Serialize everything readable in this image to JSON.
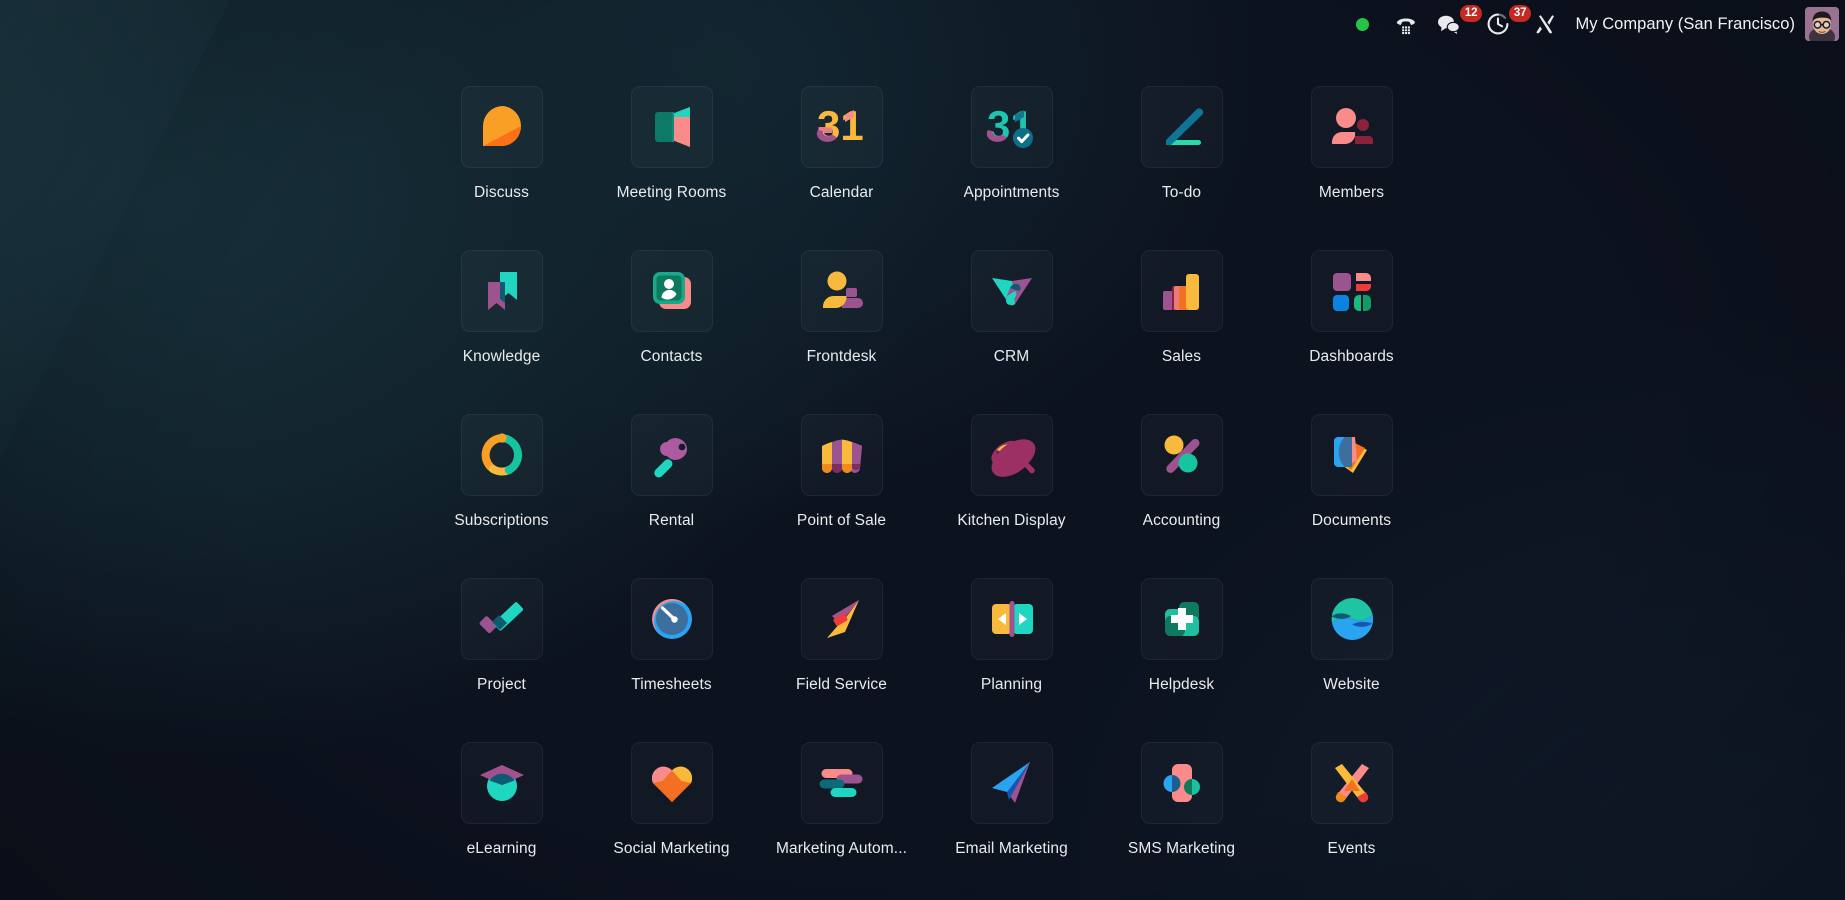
{
  "navbar": {
    "status": {
      "icon": "online-status-dot",
      "color": "#26c446",
      "label": ""
    },
    "phone": {
      "icon": "phone-dialpad-icon",
      "label": ""
    },
    "messages": {
      "icon": "chat-bubbles-icon",
      "badge": "12",
      "badge_color": "#c5291f"
    },
    "activities": {
      "icon": "clock-activity-icon",
      "badge": "37",
      "badge_color": "#c5291f"
    },
    "settings": {
      "icon": "tools-wrench-icon",
      "label": ""
    },
    "company": "My Company (San Francisco)",
    "avatar": {
      "icon": "user-avatar",
      "label": ""
    }
  },
  "apps": [
    {
      "label": "Discuss",
      "icon": "discuss-icon",
      "colors": [
        "#f99f26",
        "#f97316"
      ]
    },
    {
      "label": "Meeting Rooms",
      "icon": "meeting-rooms-icon",
      "colors": [
        "#17b8a6",
        "#0d7a68",
        "#f98b8b"
      ]
    },
    {
      "label": "Calendar",
      "icon": "calendar-31-icon",
      "colors": [
        "#f9b93c",
        "#a3508f",
        "#f98b8b"
      ]
    },
    {
      "label": "Appointments",
      "icon": "appointments-31-check-icon",
      "colors": [
        "#1fc5b0",
        "#a3508f",
        "#12788f"
      ]
    },
    {
      "label": "To-do",
      "icon": "todo-check-icon",
      "colors": [
        "#0f7596",
        "#2bd9a8"
      ]
    },
    {
      "label": "Members",
      "icon": "members-people-icon",
      "colors": [
        "#f98b8b",
        "#8c2239"
      ]
    },
    {
      "label": "Knowledge",
      "icon": "knowledge-bookmarks-icon",
      "colors": [
        "#1fd6c0",
        "#9c5490",
        "#0d5a72"
      ]
    },
    {
      "label": "Contacts",
      "icon": "contacts-card-icon",
      "colors": [
        "#17a98a",
        "#f98b8b",
        "#0d7a5f"
      ]
    },
    {
      "label": "Frontdesk",
      "icon": "frontdesk-bell-icon",
      "colors": [
        "#f9b93c",
        "#9c5490"
      ]
    },
    {
      "label": "CRM",
      "icon": "crm-arrow-icon",
      "colors": [
        "#1fd6c0",
        "#9c5490",
        "#0d5a72"
      ]
    },
    {
      "label": "Sales",
      "icon": "sales-barchart-icon",
      "colors": [
        "#9c5490",
        "#8c2239",
        "#f36f21",
        "#f9b93c"
      ]
    },
    {
      "label": "Dashboards",
      "icon": "dashboards-tiles-icon",
      "colors": [
        "#9c5490",
        "#f98b8b",
        "#ef3a3a",
        "#0a84e0",
        "#19b97f"
      ]
    },
    {
      "label": "Subscriptions",
      "icon": "subscriptions-recycle-icon",
      "colors": [
        "#f99f26",
        "#17c4a0",
        "#f9b93c"
      ]
    },
    {
      "label": "Rental",
      "icon": "rental-key-icon",
      "colors": [
        "#ad5aa0",
        "#1fd6c0",
        "#0d5a72"
      ]
    },
    {
      "label": "Point of Sale",
      "icon": "point-of-sale-awning-icon",
      "colors": [
        "#f9b93c",
        "#9c5490",
        "#f99f26",
        "#7a2f63"
      ]
    },
    {
      "label": "Kitchen Display",
      "icon": "kitchen-display-pan-icon",
      "colors": [
        "#9c2f63",
        "#f9b93c",
        "#7a2346"
      ]
    },
    {
      "label": "Accounting",
      "icon": "accounting-percent-icon",
      "colors": [
        "#f9b93c",
        "#17c4a0",
        "#9c5490"
      ]
    },
    {
      "label": "Documents",
      "icon": "documents-papers-icon",
      "colors": [
        "#2aa3f0",
        "#f36f21",
        "#f9b93c",
        "#f98b8b"
      ]
    },
    {
      "label": "Project",
      "icon": "project-check-icon",
      "colors": [
        "#1fd6c0",
        "#9c5490",
        "#0d5a72"
      ]
    },
    {
      "label": "Timesheets",
      "icon": "timesheets-clock-icon",
      "colors": [
        "#3d6f9e",
        "#f98b8b",
        "#2aa3f0"
      ]
    },
    {
      "label": "Field Service",
      "icon": "field-service-bolt-icon",
      "colors": [
        "#a3508f",
        "#f9b93c",
        "#ef3a3a"
      ]
    },
    {
      "label": "Planning",
      "icon": "planning-blocks-icon",
      "colors": [
        "#f9b93c",
        "#1fd6c0",
        "#9c5490"
      ]
    },
    {
      "label": "Helpdesk",
      "icon": "helpdesk-cross-icon",
      "colors": [
        "#1fc0a0",
        "#0d7a5f",
        "#ffffff"
      ]
    },
    {
      "label": "Website",
      "icon": "website-globe-icon",
      "colors": [
        "#1fc4a4",
        "#2aa3f0",
        "#0d5a72",
        "#1557b0"
      ]
    },
    {
      "label": "eLearning",
      "icon": "elearning-graduation-icon",
      "colors": [
        "#1fd6c0",
        "#a3508f",
        "#0d5a72"
      ]
    },
    {
      "label": "Social Marketing",
      "icon": "social-marketing-heart-icon",
      "colors": [
        "#f98b8b",
        "#f36f21",
        "#f9b93c"
      ]
    },
    {
      "label": "Marketing Autom...",
      "icon": "marketing-automation-icon",
      "colors": [
        "#f98b8b",
        "#9c5490",
        "#0d6a7a",
        "#1fd6c0"
      ]
    },
    {
      "label": "Email Marketing",
      "icon": "email-marketing-plane-icon",
      "colors": [
        "#2aa3f0",
        "#1557b0",
        "#a3508f"
      ]
    },
    {
      "label": "SMS Marketing",
      "icon": "sms-marketing-icon",
      "colors": [
        "#f98b8b",
        "#2aa3f0",
        "#0d7a5f"
      ]
    },
    {
      "label": "Events",
      "icon": "events-cones-icon",
      "colors": [
        "#f9b93c",
        "#f98b8b",
        "#f36f21",
        "#ef3a3a"
      ]
    }
  ]
}
